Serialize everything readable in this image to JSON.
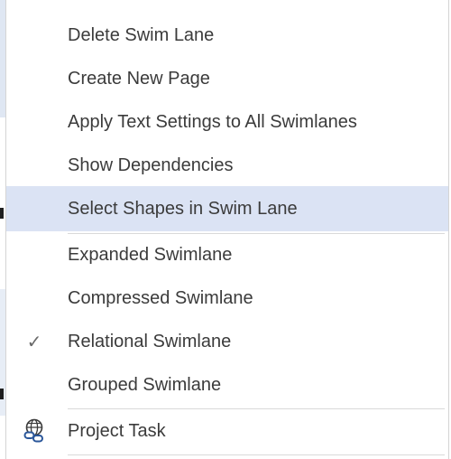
{
  "menu": {
    "items": [
      {
        "label": "Delete Swim Lane"
      },
      {
        "label": "Create New Page"
      },
      {
        "label": "Apply Text Settings to All Swimlanes"
      },
      {
        "label": "Show Dependencies"
      },
      {
        "label": "Select Shapes in Swim Lane",
        "state": "hovered"
      },
      {
        "label": "Expanded Swimlane"
      },
      {
        "label": "Compressed Swimlane"
      },
      {
        "label": "Relational Swimlane",
        "checked": true,
        "icon": "check-icon"
      },
      {
        "label": "Grouped Swimlane"
      },
      {
        "label": "Project Task",
        "icon": "globe-link-icon"
      }
    ],
    "check_glyph": "✓"
  },
  "colors": {
    "highlight": "#dbe3f4",
    "text": "#3b3b3b",
    "icon_blue": "#2b579a"
  }
}
